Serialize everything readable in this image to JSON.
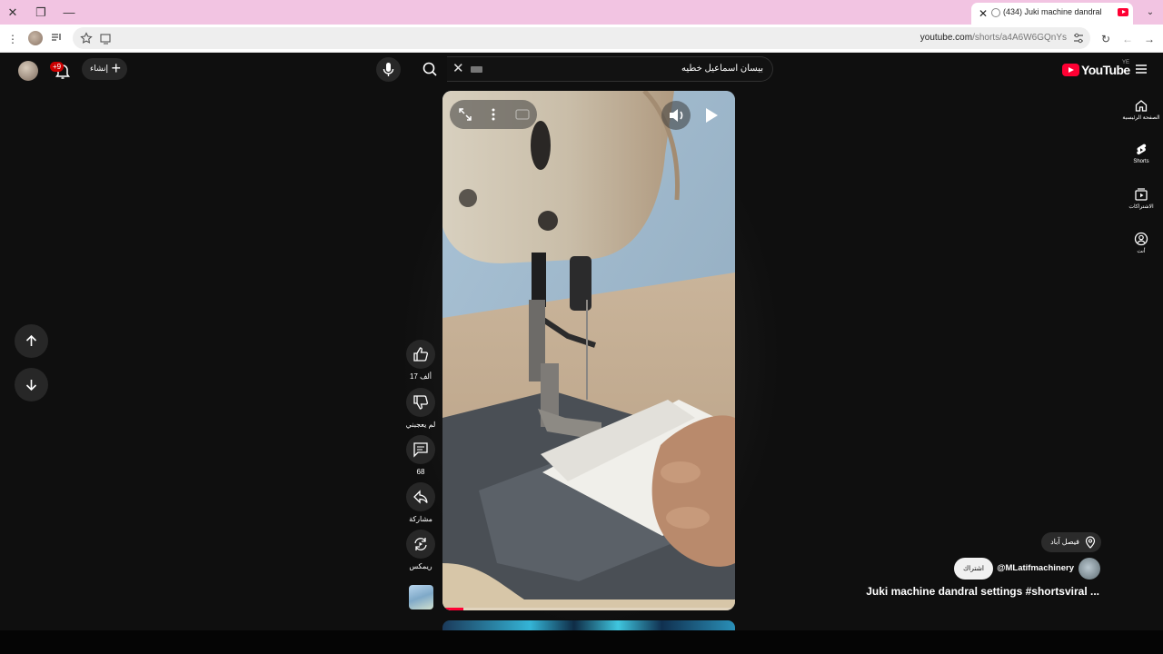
{
  "browser": {
    "tab_title": "(434) Juki machine dandral",
    "url_host": "youtube.com",
    "url_path": "/shorts/a4A6W6GQnYs"
  },
  "masthead": {
    "notification_count": "+9",
    "create_label": "إنشاء",
    "search_query": "بيسان اسماعيل خطيه",
    "logo_text": "YouTube",
    "country_code": "YE"
  },
  "rail": [
    {
      "label": "الصفحة الرئيسية",
      "icon": "home-icon"
    },
    {
      "label": "Shorts",
      "icon": "shorts-icon"
    },
    {
      "label": "الاشتراكات",
      "icon": "subscriptions-icon"
    },
    {
      "label": "أنت",
      "icon": "you-icon"
    }
  ],
  "actions": {
    "like_count": "17 ألف",
    "dislike_label": "لم يعجبني",
    "comments_count": "68",
    "share_label": "مشاركة",
    "remix_label": "ريمكس"
  },
  "short": {
    "location": "فيصل آباد",
    "channel": "@MLatifmachinery",
    "subscribe_label": "اشتراك",
    "title": "Juki machine dandral settings #shortsviral ...",
    "progress": 0.07
  },
  "colors": {
    "accent": "#ff0033",
    "background": "#0f0f0f",
    "tab_strip": "#f2c4e2"
  }
}
